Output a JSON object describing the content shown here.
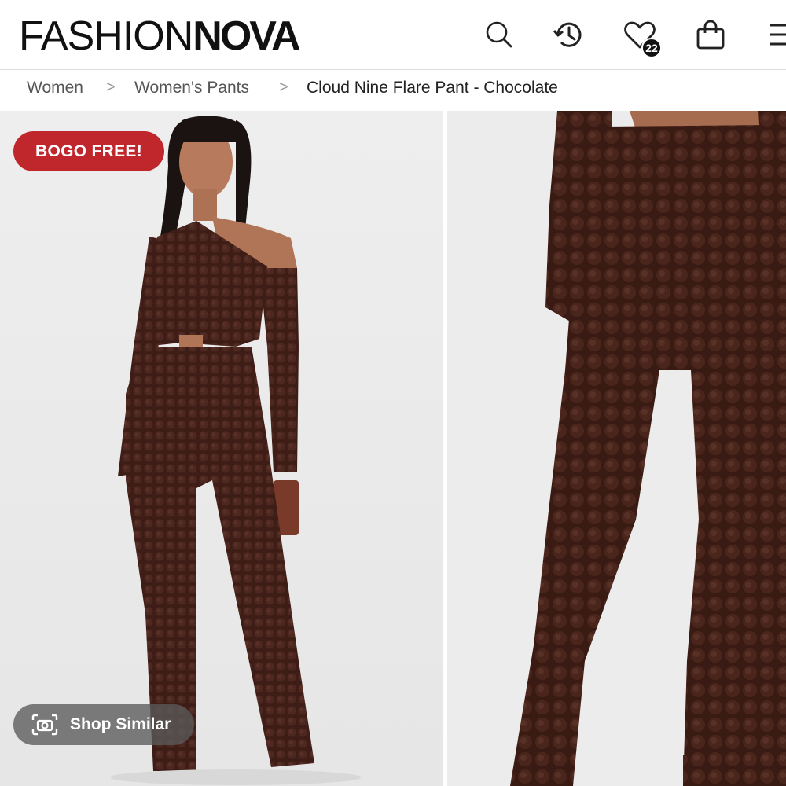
{
  "header": {
    "logo_light": "FASHION",
    "logo_bold": "NOVA",
    "wishlist_count": "22",
    "icons": [
      "search-icon",
      "history-icon",
      "heart-icon",
      "shopping-bag-icon",
      "menu-icon"
    ]
  },
  "breadcrumb": {
    "items": [
      "Women",
      "Women's Pants",
      "Cloud Nine Flare Pant - Chocolate"
    ],
    "separator": ">"
  },
  "product": {
    "promo_badge": "BOGO FREE!",
    "shop_similar_label": "Shop Similar"
  },
  "colors": {
    "promo_red": "#c0272d",
    "garment_brown": "#3e1d16",
    "image_background": "#ececec"
  }
}
